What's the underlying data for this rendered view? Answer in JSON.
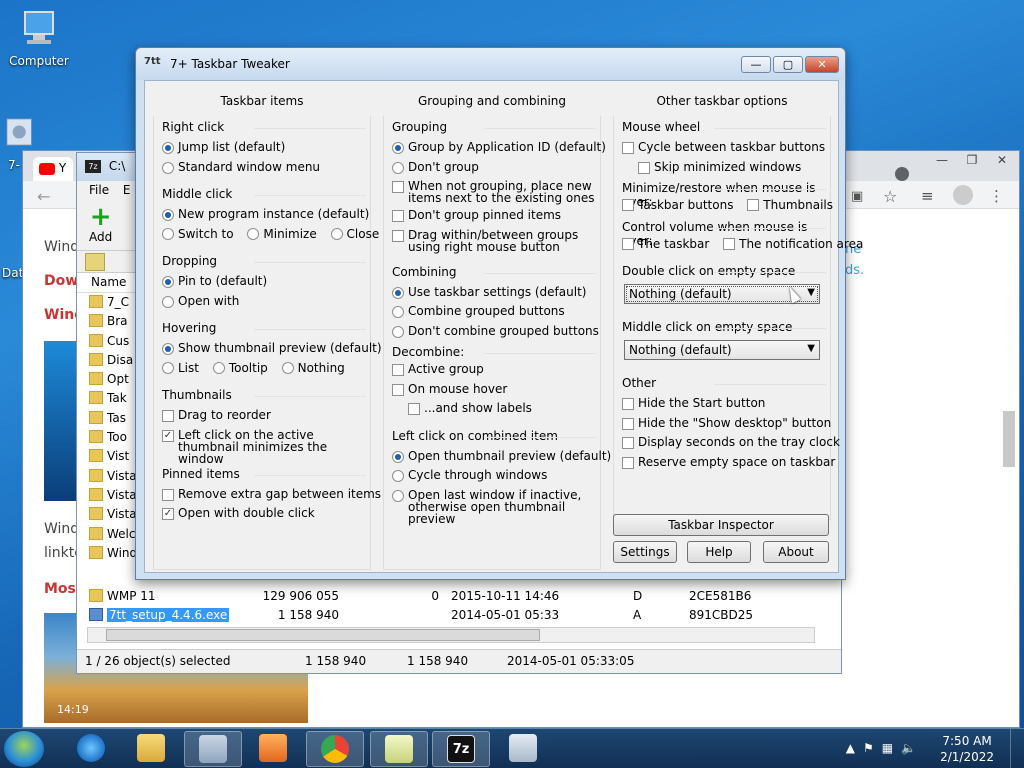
{
  "desktop": {
    "icons": [
      {
        "label": "Computer",
        "icon": "computer-icon"
      },
      {
        "label": "7-",
        "icon": "installer-icon"
      }
    ],
    "side_labels": [
      "Dat"
    ]
  },
  "chrome": {
    "tab_prefix": "Y",
    "win_controls": [
      "—",
      "❐",
      "✕"
    ],
    "left_texts": [
      "Wind",
      "Dow",
      "Wind",
      "Wind",
      "linkte",
      "Mosa"
    ],
    "right_texts": [
      "ne",
      "ds."
    ],
    "thumb_time": "14:19"
  },
  "zip": {
    "title_prefix": "C:\\",
    "menu": [
      "File",
      "E"
    ],
    "add_label": "Add",
    "column_name": "Name",
    "folders": [
      "7_C",
      "Bra",
      "Cus",
      "Disa",
      "Opt",
      "Tak",
      "Tas",
      "Too",
      "Vist",
      "Vista",
      "Vista",
      "Vista",
      "Welc",
      "Wind"
    ],
    "rows": [
      {
        "name": "WMP 11",
        "size": "129 906 055",
        "packed": "0",
        "modified": "2015-10-11 14:46",
        "attr": "D",
        "crc": "2CE581B6"
      },
      {
        "name": "7tt_setup_4.4.6.exe",
        "size": "1 158 940",
        "packed": "",
        "modified": "2014-05-01 05:33",
        "attr": "A",
        "crc": "891CBD25"
      }
    ],
    "status": {
      "selected": "1 / 26 object(s) selected",
      "size": "1 158 940",
      "packed": "1 158 940",
      "modified": "2014-05-01 05:33:05"
    }
  },
  "tweaker": {
    "title": "7+ Taskbar Tweaker",
    "logo": "7tt",
    "win_controls": {
      "min": "—",
      "max": "▢",
      "close": "✕"
    },
    "col1": {
      "header": "Taskbar items",
      "right_click": {
        "label": "Right click",
        "jump": "Jump list (default)",
        "standard": "Standard window menu"
      },
      "middle_click": {
        "label": "Middle click",
        "new": "New program instance (default)",
        "switch": "Switch to",
        "minimize": "Minimize",
        "close": "Close"
      },
      "dropping": {
        "label": "Dropping",
        "pin": "Pin to (default)",
        "open": "Open with"
      },
      "hovering": {
        "label": "Hovering",
        "show": "Show thumbnail preview (default)",
        "list": "List",
        "tooltip": "Tooltip",
        "nothing": "Nothing"
      },
      "thumbnails": {
        "label": "Thumbnails",
        "drag": "Drag to reorder",
        "leftclick": "Left click on the active thumbnail minimizes the window"
      },
      "pinned": {
        "label": "Pinned items",
        "remove": "Remove extra gap between items",
        "dbl": "Open with double click"
      }
    },
    "col2": {
      "header": "Grouping and combining",
      "grouping": {
        "label": "Grouping",
        "appid": "Group by Application ID (default)",
        "dont": "Don't group",
        "notgrouping": "When not grouping, place new items next to the existing ones",
        "pinned": "Don't group pinned items",
        "drag": "Drag within/between groups using right mouse button"
      },
      "combining": {
        "label": "Combining",
        "use": "Use taskbar settings (default)",
        "combine": "Combine grouped buttons",
        "dont": "Don't combine grouped buttons"
      },
      "decombine": {
        "label": "Decombine:",
        "active": "Active group",
        "hover": "On mouse hover",
        "labels": "...and show labels"
      },
      "leftclick": {
        "label": "Left click on combined item",
        "open": "Open thumbnail preview (default)",
        "cycle": "Cycle through windows",
        "last": "Open last window if inactive, otherwise open thumbnail preview"
      }
    },
    "col3": {
      "header": "Other taskbar options",
      "wheel": {
        "label": "Mouse wheel",
        "cycle": "Cycle between taskbar buttons",
        "skip": "Skip minimized windows"
      },
      "minrestore": {
        "label": "Minimize/restore when mouse is over:",
        "buttons": "Taskbar buttons",
        "thumbs": "Thumbnails"
      },
      "volume": {
        "label": "Control volume when mouse is over:",
        "taskbar": "The taskbar",
        "notif": "The notification area"
      },
      "dblclick": {
        "label": "Double click on empty space",
        "value": "Nothing (default)"
      },
      "midclick": {
        "label": "Middle click on empty space",
        "value": "Nothing (default)"
      },
      "other": {
        "label": "Other",
        "start": "Hide the Start button",
        "desktop": "Hide the \"Show desktop\" button",
        "seconds": "Display seconds on the tray clock",
        "reserve": "Reserve empty space on taskbar"
      }
    },
    "buttons": {
      "inspector": "Taskbar Inspector",
      "settings": "Settings",
      "help": "Help",
      "about": "About"
    }
  },
  "taskbar": {
    "clock_time": "7:50 AM",
    "clock_date": "2/1/2022",
    "apps": [
      "internet-explorer-icon",
      "explorer-icon",
      "tweaker-icon",
      "media-player-icon",
      "chrome-icon",
      "notepad-icon",
      "7zip-icon",
      "calculator-icon"
    ],
    "zip_label": "7z"
  }
}
